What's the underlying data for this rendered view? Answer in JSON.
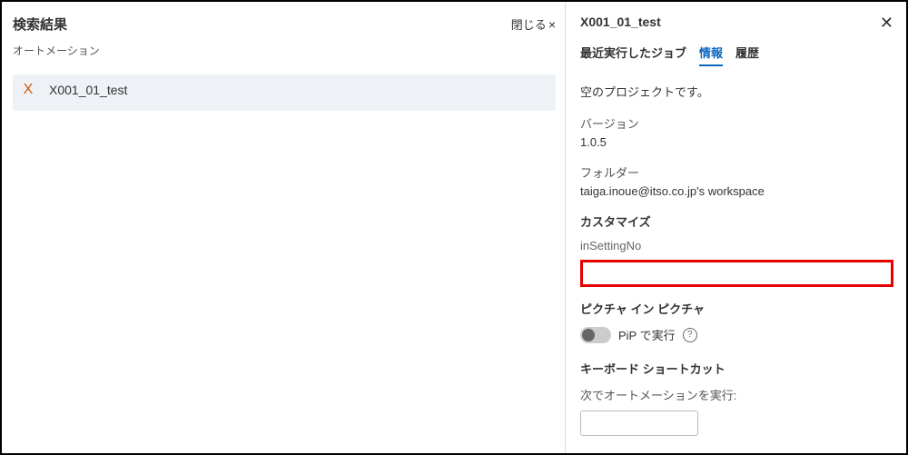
{
  "left": {
    "title": "検索結果",
    "close_label": "閉じる",
    "section_label": "オートメーション",
    "result": {
      "icon_letter": "X",
      "name": "X001_01_test"
    }
  },
  "right": {
    "title": "X001_01_test",
    "tabs": {
      "recent": "最近実行したジョブ",
      "info": "情報",
      "history": "履歴"
    },
    "project_desc": "空のプロジェクトです。",
    "version_label": "バージョン",
    "version_value": "1.0.5",
    "folder_label": "フォルダー",
    "folder_value": "taiga.inoue@itso.co.jp's workspace",
    "customize_head": "カスタマイズ",
    "setting_label": "inSettingNo",
    "pip_head": "ピクチャ イン ピクチャ",
    "pip_label": "PiP で実行",
    "shortcut_head": "キーボード ショートカット",
    "shortcut_label": "次でオートメーションを実行:"
  }
}
